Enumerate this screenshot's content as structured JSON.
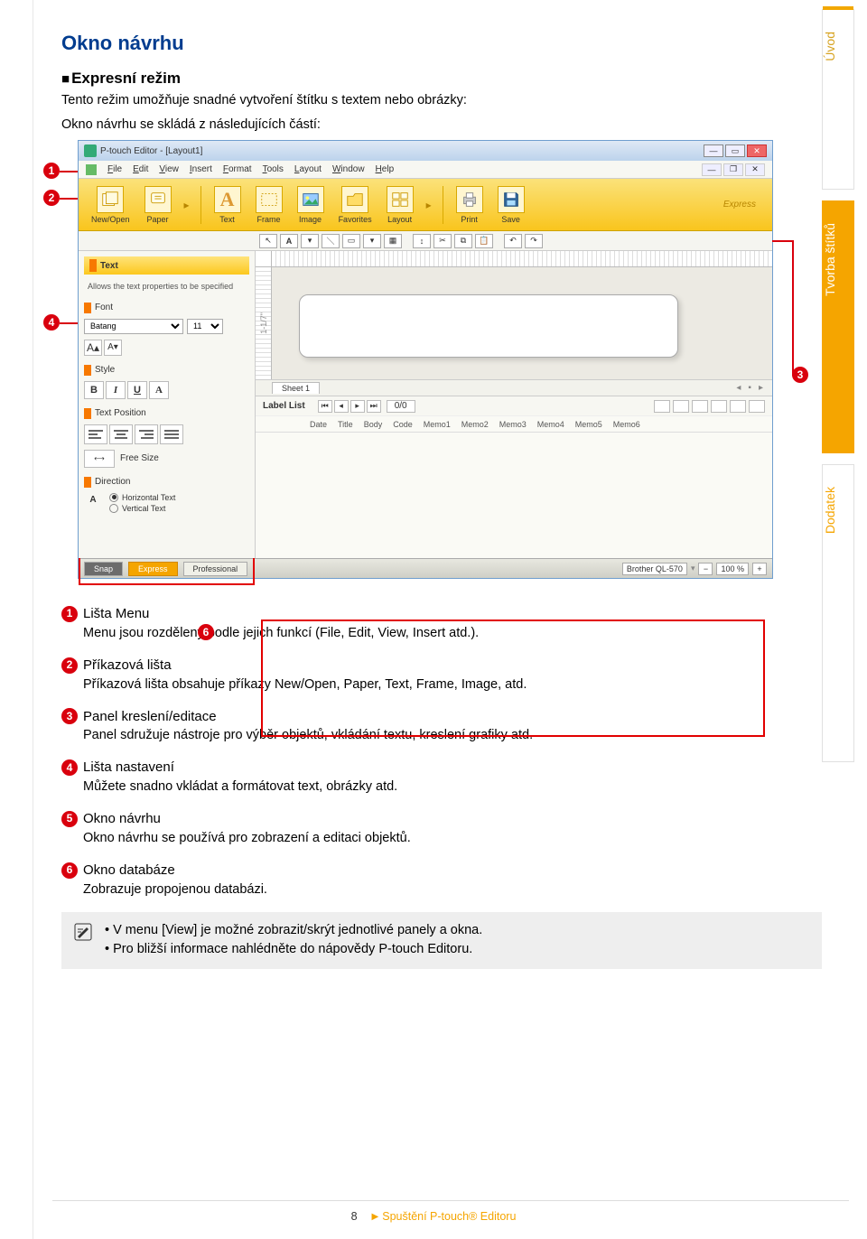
{
  "doc": {
    "title": "Okno návrhu",
    "subtitle": "Expresní režim",
    "intro1": "Tento režim umožňuje snadné vytvoření štítku s textem nebo obrázky:",
    "intro2": "Okno návrhu se skládá z následujících částí:"
  },
  "side": {
    "uvod": "Úvod",
    "tvorba": "Tvorba štítků",
    "dodatek": "Dodatek"
  },
  "markers": {
    "m1": "1",
    "m2": "2",
    "m3": "3",
    "m4": "4",
    "m5": "5",
    "m6": "6"
  },
  "editor": {
    "window_title": "P-touch Editor - [Layout1]",
    "menu": [
      "File",
      "Edit",
      "View",
      "Insert",
      "Format",
      "Tools",
      "Layout",
      "Window",
      "Help"
    ],
    "toolbar": {
      "newopen": "New/Open",
      "paper": "Paper",
      "text": "Text",
      "frame": "Frame",
      "image": "Image",
      "favorites": "Favorites",
      "layout": "Layout",
      "print": "Print",
      "save": "Save",
      "express": "Express"
    },
    "left_panel": {
      "title": "Text",
      "subtitle": "Allows the text properties to be specified",
      "font_label": "Font",
      "font_name": "Batang",
      "font_size": "11",
      "style_label": "Style",
      "style_b": "B",
      "style_i": "I",
      "style_u": "U",
      "pos_label": "Text Position",
      "free_size": "Free Size",
      "dir_label": "Direction",
      "dir_a": "A",
      "dir_horizontal": "Horizontal Text",
      "dir_vertical": "Vertical Text"
    },
    "ruler_label": "1-1/7\"",
    "sheet_tab": "Sheet 1",
    "labellist": {
      "label": "Label List",
      "counter": "0/0"
    },
    "fields": [
      "Date",
      "Title",
      "Body",
      "Code",
      "Memo1",
      "Memo2",
      "Memo3",
      "Memo4",
      "Memo5",
      "Memo6"
    ],
    "status": {
      "snap": "Snap",
      "express": "Express",
      "professional": "Professional",
      "printer": "Brother QL-570",
      "zoom": "100 %"
    }
  },
  "legend": {
    "m1_title": "Lišta Menu",
    "m1_desc": "Menu jsou rozděleny podle jejich funkcí (File, Edit, View, Insert atd.).",
    "m2_title": "Příkazová lišta",
    "m2_desc": "Příkazová lišta obsahuje příkazy New/Open, Paper, Text, Frame, Image, atd.",
    "m3_title": "Panel kreslení/editace",
    "m3_desc": "Panel sdružuje nástroje pro výběr objektů, vkládání textu, kreslení grafiky atd.",
    "m4_title": "Lišta nastavení",
    "m4_desc": "Můžete snadno vkládat a formátovat text, obrázky atd.",
    "m5_title": "Okno návrhu",
    "m5_desc": "Okno návrhu se používá pro zobrazení a editaci objektů.",
    "m6_title": "Okno databáze",
    "m6_desc": "Zobrazuje propojenou databázi."
  },
  "note": {
    "line1": "V menu [View] je možné zobrazit/skrýt jednotlivé panely a okna.",
    "line2": "Pro bližší informace nahlédněte do nápovědy P-touch Editoru."
  },
  "footer": {
    "page": "8",
    "breadcrumb": "Spuštění P-touch® Editoru"
  }
}
